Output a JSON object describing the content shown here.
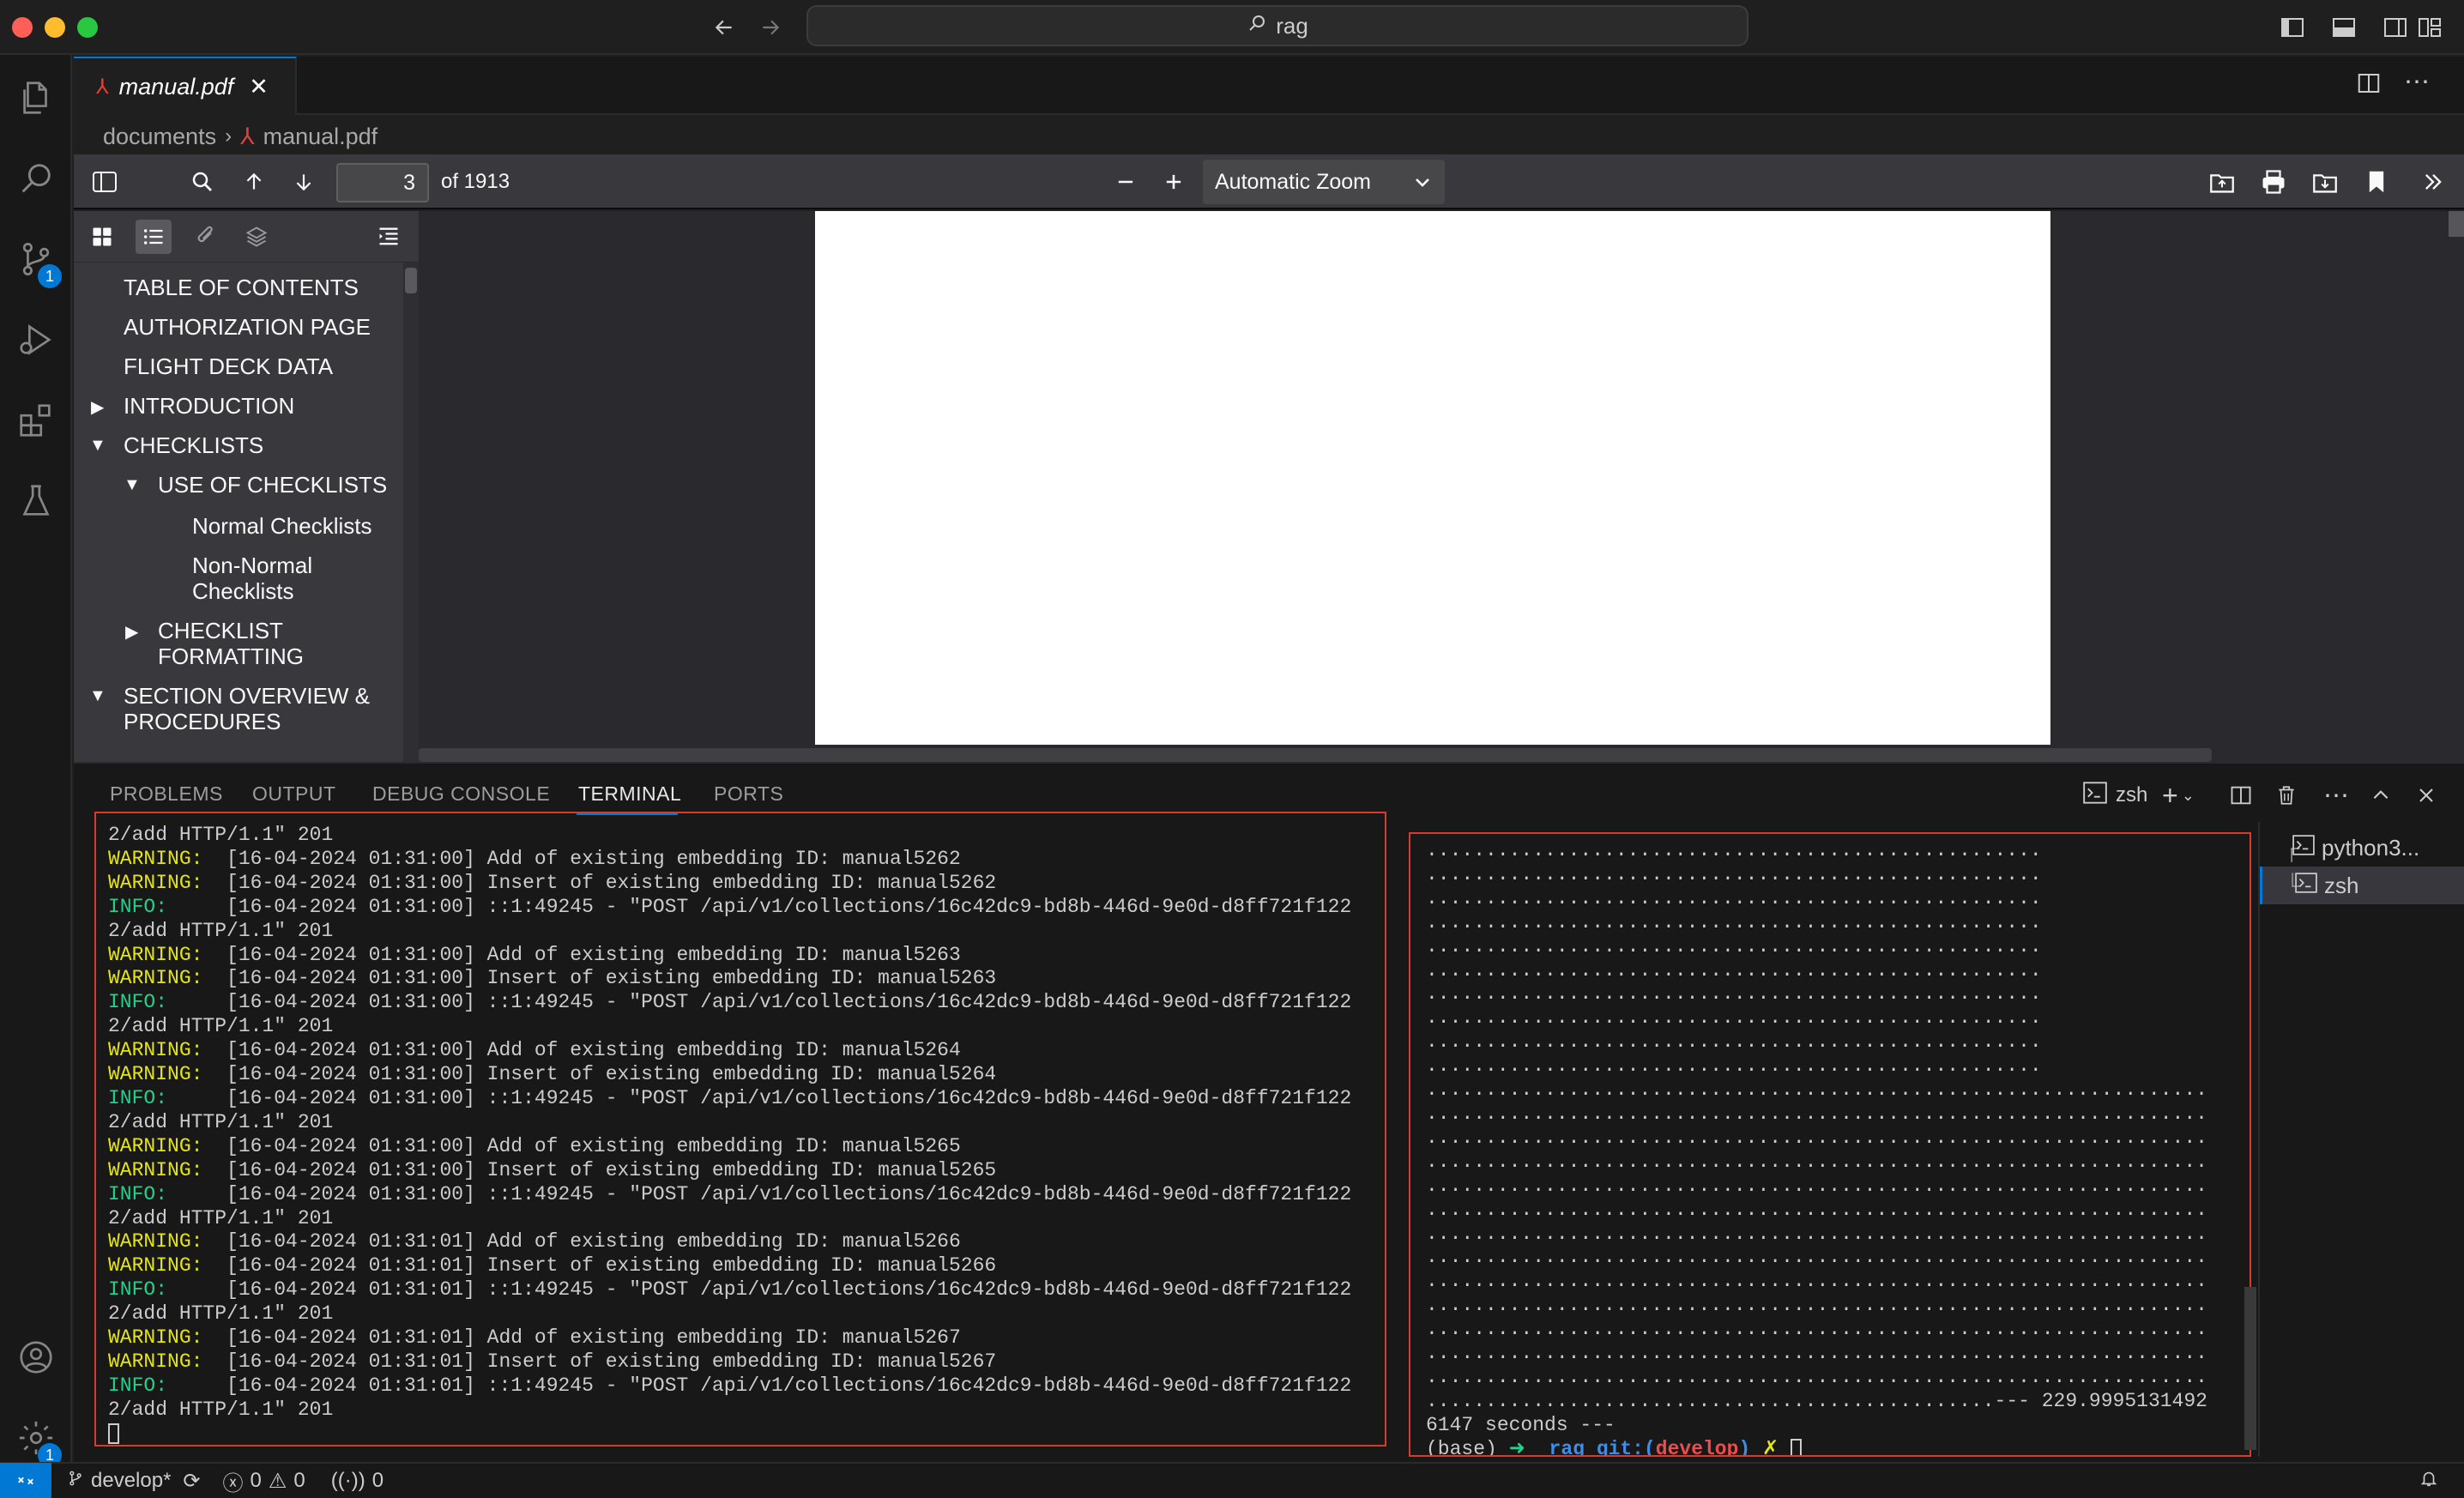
{
  "window": {
    "search_text": "rag"
  },
  "activity_bar": {
    "scm_badge": "1",
    "settings_badge": "1"
  },
  "editor": {
    "tab_label": "manual.pdf",
    "breadcrumb": [
      "documents",
      "manual.pdf"
    ]
  },
  "pdf": {
    "page_number": "3",
    "page_count_label": "of 1913",
    "zoom": "Automatic Zoom",
    "toc": [
      {
        "label": "TABLE OF CONTENTS"
      },
      {
        "label": "AUTHORIZATION PAGE"
      },
      {
        "label": "FLIGHT DECK DATA"
      },
      {
        "label": "INTRODUCTION",
        "state": "collapsed"
      },
      {
        "label": "CHECKLISTS",
        "state": "expanded"
      },
      {
        "label": "USE OF CHECKLISTS",
        "state": "expanded"
      },
      {
        "label": "Normal Checklists"
      },
      {
        "label": "Non-Normal Checklists"
      },
      {
        "label": "CHECKLIST FORMATTING",
        "state": "collapsed"
      },
      {
        "label": "SECTION OVERVIEW & PROCEDURES",
        "state": "expanded"
      }
    ]
  },
  "panel": {
    "tabs": [
      "PROBLEMS",
      "OUTPUT",
      "DEBUG CONSOLE",
      "TERMINAL",
      "PORTS"
    ],
    "active_tab": "TERMINAL",
    "shell_label": "zsh",
    "terminal_list": [
      "python3...",
      "zsh"
    ],
    "left_terminal": [
      {
        "level": "",
        "text": "2/add HTTP/1.1\" 201"
      },
      {
        "level": "WARNING:",
        "text": "  [16-04-2024 01:31:00] Add of existing embedding ID: manual5262"
      },
      {
        "level": "WARNING:",
        "text": "  [16-04-2024 01:31:00] Insert of existing embedding ID: manual5262"
      },
      {
        "level": "INFO:",
        "text": "     [16-04-2024 01:31:00] ::1:49245 - \"POST /api/v1/collections/16c42dc9-bd8b-446d-9e0d-d8ff721f122"
      },
      {
        "level": "",
        "text": "2/add HTTP/1.1\" 201"
      },
      {
        "level": "WARNING:",
        "text": "  [16-04-2024 01:31:00] Add of existing embedding ID: manual5263"
      },
      {
        "level": "WARNING:",
        "text": "  [16-04-2024 01:31:00] Insert of existing embedding ID: manual5263"
      },
      {
        "level": "INFO:",
        "text": "     [16-04-2024 01:31:00] ::1:49245 - \"POST /api/v1/collections/16c42dc9-bd8b-446d-9e0d-d8ff721f122"
      },
      {
        "level": "",
        "text": "2/add HTTP/1.1\" 201"
      },
      {
        "level": "WARNING:",
        "text": "  [16-04-2024 01:31:00] Add of existing embedding ID: manual5264"
      },
      {
        "level": "WARNING:",
        "text": "  [16-04-2024 01:31:00] Insert of existing embedding ID: manual5264"
      },
      {
        "level": "INFO:",
        "text": "     [16-04-2024 01:31:00] ::1:49245 - \"POST /api/v1/collections/16c42dc9-bd8b-446d-9e0d-d8ff721f122"
      },
      {
        "level": "",
        "text": "2/add HTTP/1.1\" 201"
      },
      {
        "level": "WARNING:",
        "text": "  [16-04-2024 01:31:00] Add of existing embedding ID: manual5265"
      },
      {
        "level": "WARNING:",
        "text": "  [16-04-2024 01:31:00] Insert of existing embedding ID: manual5265"
      },
      {
        "level": "INFO:",
        "text": "     [16-04-2024 01:31:00] ::1:49245 - \"POST /api/v1/collections/16c42dc9-bd8b-446d-9e0d-d8ff721f122"
      },
      {
        "level": "",
        "text": "2/add HTTP/1.1\" 201"
      },
      {
        "level": "WARNING:",
        "text": "  [16-04-2024 01:31:01] Add of existing embedding ID: manual5266"
      },
      {
        "level": "WARNING:",
        "text": "  [16-04-2024 01:31:01] Insert of existing embedding ID: manual5266"
      },
      {
        "level": "INFO:",
        "text": "     [16-04-2024 01:31:01] ::1:49245 - \"POST /api/v1/collections/16c42dc9-bd8b-446d-9e0d-d8ff721f122"
      },
      {
        "level": "",
        "text": "2/add HTTP/1.1\" 201"
      },
      {
        "level": "WARNING:",
        "text": "  [16-04-2024 01:31:01] Add of existing embedding ID: manual5267"
      },
      {
        "level": "WARNING:",
        "text": "  [16-04-2024 01:31:01] Insert of existing embedding ID: manual5267"
      },
      {
        "level": "INFO:",
        "text": "     [16-04-2024 01:31:01] ::1:49245 - \"POST /api/v1/collections/16c42dc9-bd8b-446d-9e0d-d8ff721f122"
      },
      {
        "level": "",
        "text": "2/add HTTP/1.1\" 201"
      }
    ],
    "right_terminal": {
      "dot_lines_short": 10,
      "dot_lines_long": 13,
      "last_progress_suffix": "--- 229.9995131492",
      "seconds_line": "6147 seconds ---",
      "prompt_env": "(base)",
      "prompt_arrow": "➜",
      "prompt_dir": "rag",
      "prompt_git_label": "git:(",
      "prompt_branch": "develop",
      "prompt_git_close": ")",
      "prompt_dirty": "✗"
    }
  },
  "status_bar": {
    "branch": "develop*",
    "errors": "0",
    "warnings": "0",
    "ports": "0"
  },
  "colors": {
    "accent": "#0078d4",
    "warning": "#e5e510",
    "info": "#23d18b",
    "highlight_border": "#d93a2b"
  }
}
